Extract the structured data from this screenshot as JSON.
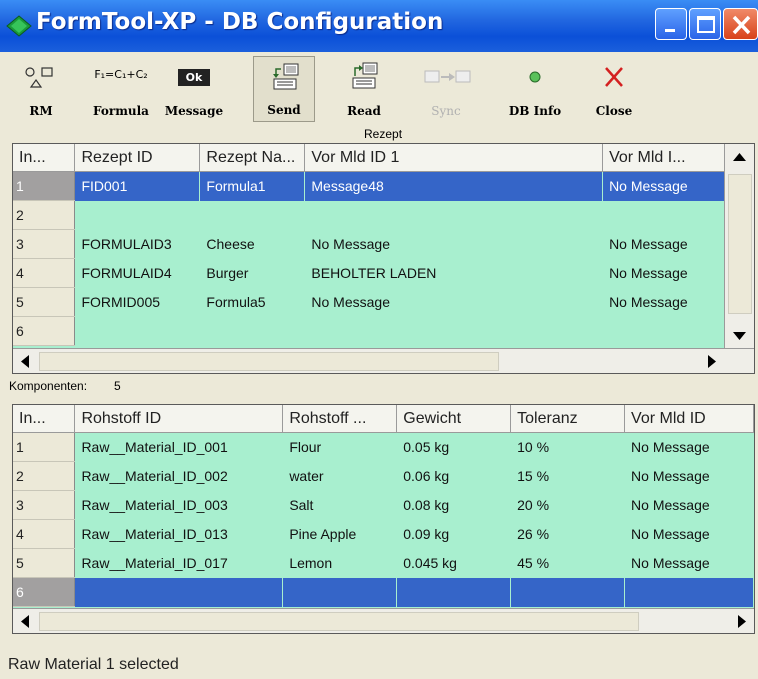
{
  "window": {
    "title": "FormTool-XP - DB Configuration"
  },
  "toolbar": {
    "rm_label": "RM",
    "formula_label": "Formula",
    "formula_icon_text": "F₁=C₁+C₂",
    "message_label": "Message",
    "message_icon_text": "Ok",
    "send_label": "Send",
    "read_label": "Read",
    "sync_label": "Sync",
    "dbinfo_label": "DB Info",
    "close_label": "Close"
  },
  "rezept": {
    "section_title": "Rezept",
    "columns": [
      "In...",
      "Rezept ID",
      "Rezept Na...",
      "Vor Mld ID 1",
      "Vor Mld I..."
    ],
    "rows": [
      [
        "1",
        "FID001",
        "Formula1",
        "Message48",
        "No Message"
      ],
      [
        "2",
        "",
        "",
        "",
        ""
      ],
      [
        "3",
        "FORMULAID3",
        "Cheese",
        "No Message",
        "No Message"
      ],
      [
        "4",
        "FORMULAID4",
        "Burger",
        "BEHOLTER LADEN",
        "No Message"
      ],
      [
        "5",
        "FORMID005",
        "Formula5",
        "No Message",
        "No Message"
      ],
      [
        "6",
        "",
        "",
        "",
        ""
      ]
    ],
    "selected_row": 0
  },
  "komponenten": {
    "label": "Komponenten:",
    "count": "5",
    "columns": [
      "In...",
      "Rohstoff ID",
      "Rohstoff ...",
      "Gewicht",
      "Toleranz",
      "Vor Mld ID"
    ],
    "rows": [
      [
        "1",
        "Raw__Material_ID_001",
        "Flour",
        "0.05 kg",
        "10 %",
        "No Message"
      ],
      [
        "2",
        "Raw__Material_ID_002",
        "water",
        "0.06 kg",
        "15 %",
        "No Message"
      ],
      [
        "3",
        "Raw__Material_ID_003",
        "Salt",
        "0.08 kg",
        "20 %",
        "No Message"
      ],
      [
        "4",
        "Raw__Material_ID_013",
        "Pine Apple",
        "0.09 kg",
        "26 %",
        "No Message"
      ],
      [
        "5",
        "Raw__Material_ID_017",
        "Lemon",
        "0.045 kg",
        "45 %",
        "No Message"
      ],
      [
        "6",
        "",
        "",
        "",
        "",
        ""
      ]
    ],
    "selected_row": 5
  },
  "status": {
    "text": "Raw Material 1 selected"
  },
  "colors": {
    "grid_bg": "#a8efcf",
    "selection": "#3565c8",
    "titlebar": "#0b50d8"
  }
}
